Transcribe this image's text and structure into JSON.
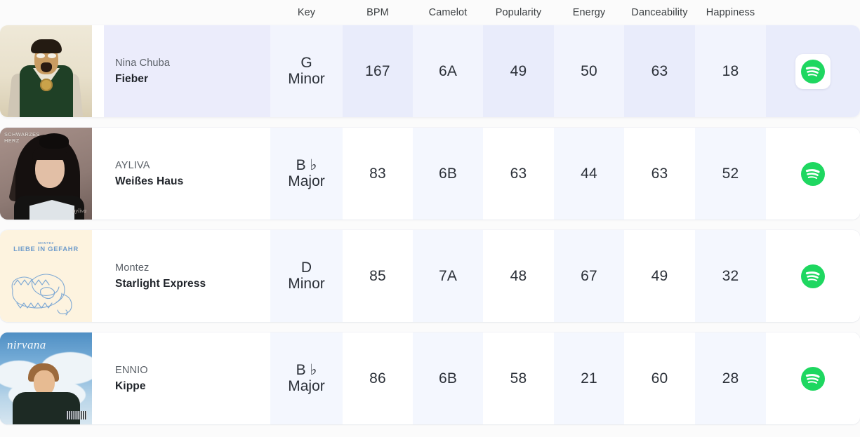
{
  "table": {
    "columns": [
      {
        "key": "art",
        "label": ""
      },
      {
        "key": "name",
        "label": ""
      },
      {
        "key": "key",
        "label": "Key"
      },
      {
        "key": "bpm",
        "label": "BPM"
      },
      {
        "key": "camelot",
        "label": "Camelot"
      },
      {
        "key": "popularity",
        "label": "Popularity"
      },
      {
        "key": "energy",
        "label": "Energy"
      },
      {
        "key": "danceability",
        "label": "Danceability"
      },
      {
        "key": "happiness",
        "label": "Happiness"
      },
      {
        "key": "link",
        "label": ""
      }
    ],
    "headers": {
      "key": "Key",
      "bpm": "BPM",
      "camelot": "Camelot",
      "popularity": "Popularity",
      "energy": "Energy",
      "danceability": "Danceability",
      "happiness": "Happiness"
    },
    "rows": [
      {
        "artist": "Nina Chuba",
        "title": "Fieber",
        "key_root": "G",
        "key_mode": "Minor",
        "bpm": "167",
        "camelot": "6A",
        "popularity": "49",
        "energy": "50",
        "danceability": "63",
        "happiness": "18",
        "link_icon": "spotify-icon",
        "highlighted": true,
        "cover_text": ""
      },
      {
        "artist": "AYLIVA",
        "title": "Weißes Haus",
        "key_root": "B ♭",
        "key_mode": "Major",
        "bpm": "83",
        "camelot": "6B",
        "popularity": "63",
        "energy": "44",
        "danceability": "63",
        "happiness": "52",
        "link_icon": "spotify-icon",
        "highlighted": false,
        "cover_text": "SCHWARZES\nHERZ",
        "cover_signature": "ayliva"
      },
      {
        "artist": "Montez",
        "title": "Starlight Express",
        "key_root": "D",
        "key_mode": "Minor",
        "bpm": "85",
        "camelot": "7A",
        "popularity": "48",
        "energy": "67",
        "danceability": "49",
        "happiness": "32",
        "link_icon": "spotify-icon",
        "highlighted": false,
        "cover_text": "LIEBE IN GEFAHR",
        "cover_supertext": "MONTEZ"
      },
      {
        "artist": "ENNIO",
        "title": "Kippe",
        "key_root": "B ♭",
        "key_mode": "Major",
        "bpm": "86",
        "camelot": "6B",
        "popularity": "58",
        "energy": "21",
        "danceability": "60",
        "happiness": "28",
        "link_icon": "spotify-icon",
        "highlighted": false,
        "cover_text": "nirvana"
      }
    ]
  },
  "colors": {
    "page_background": "#fbfbfb",
    "column_tint": "#f4f7fe",
    "row_highlight": "#e9ecfb",
    "row_highlight_tint": "#f2f4fd",
    "spotify_green": "#1ed760",
    "text_primary": "#2b3038",
    "text_secondary": "#5b6168",
    "header_text": "#3c4043"
  }
}
